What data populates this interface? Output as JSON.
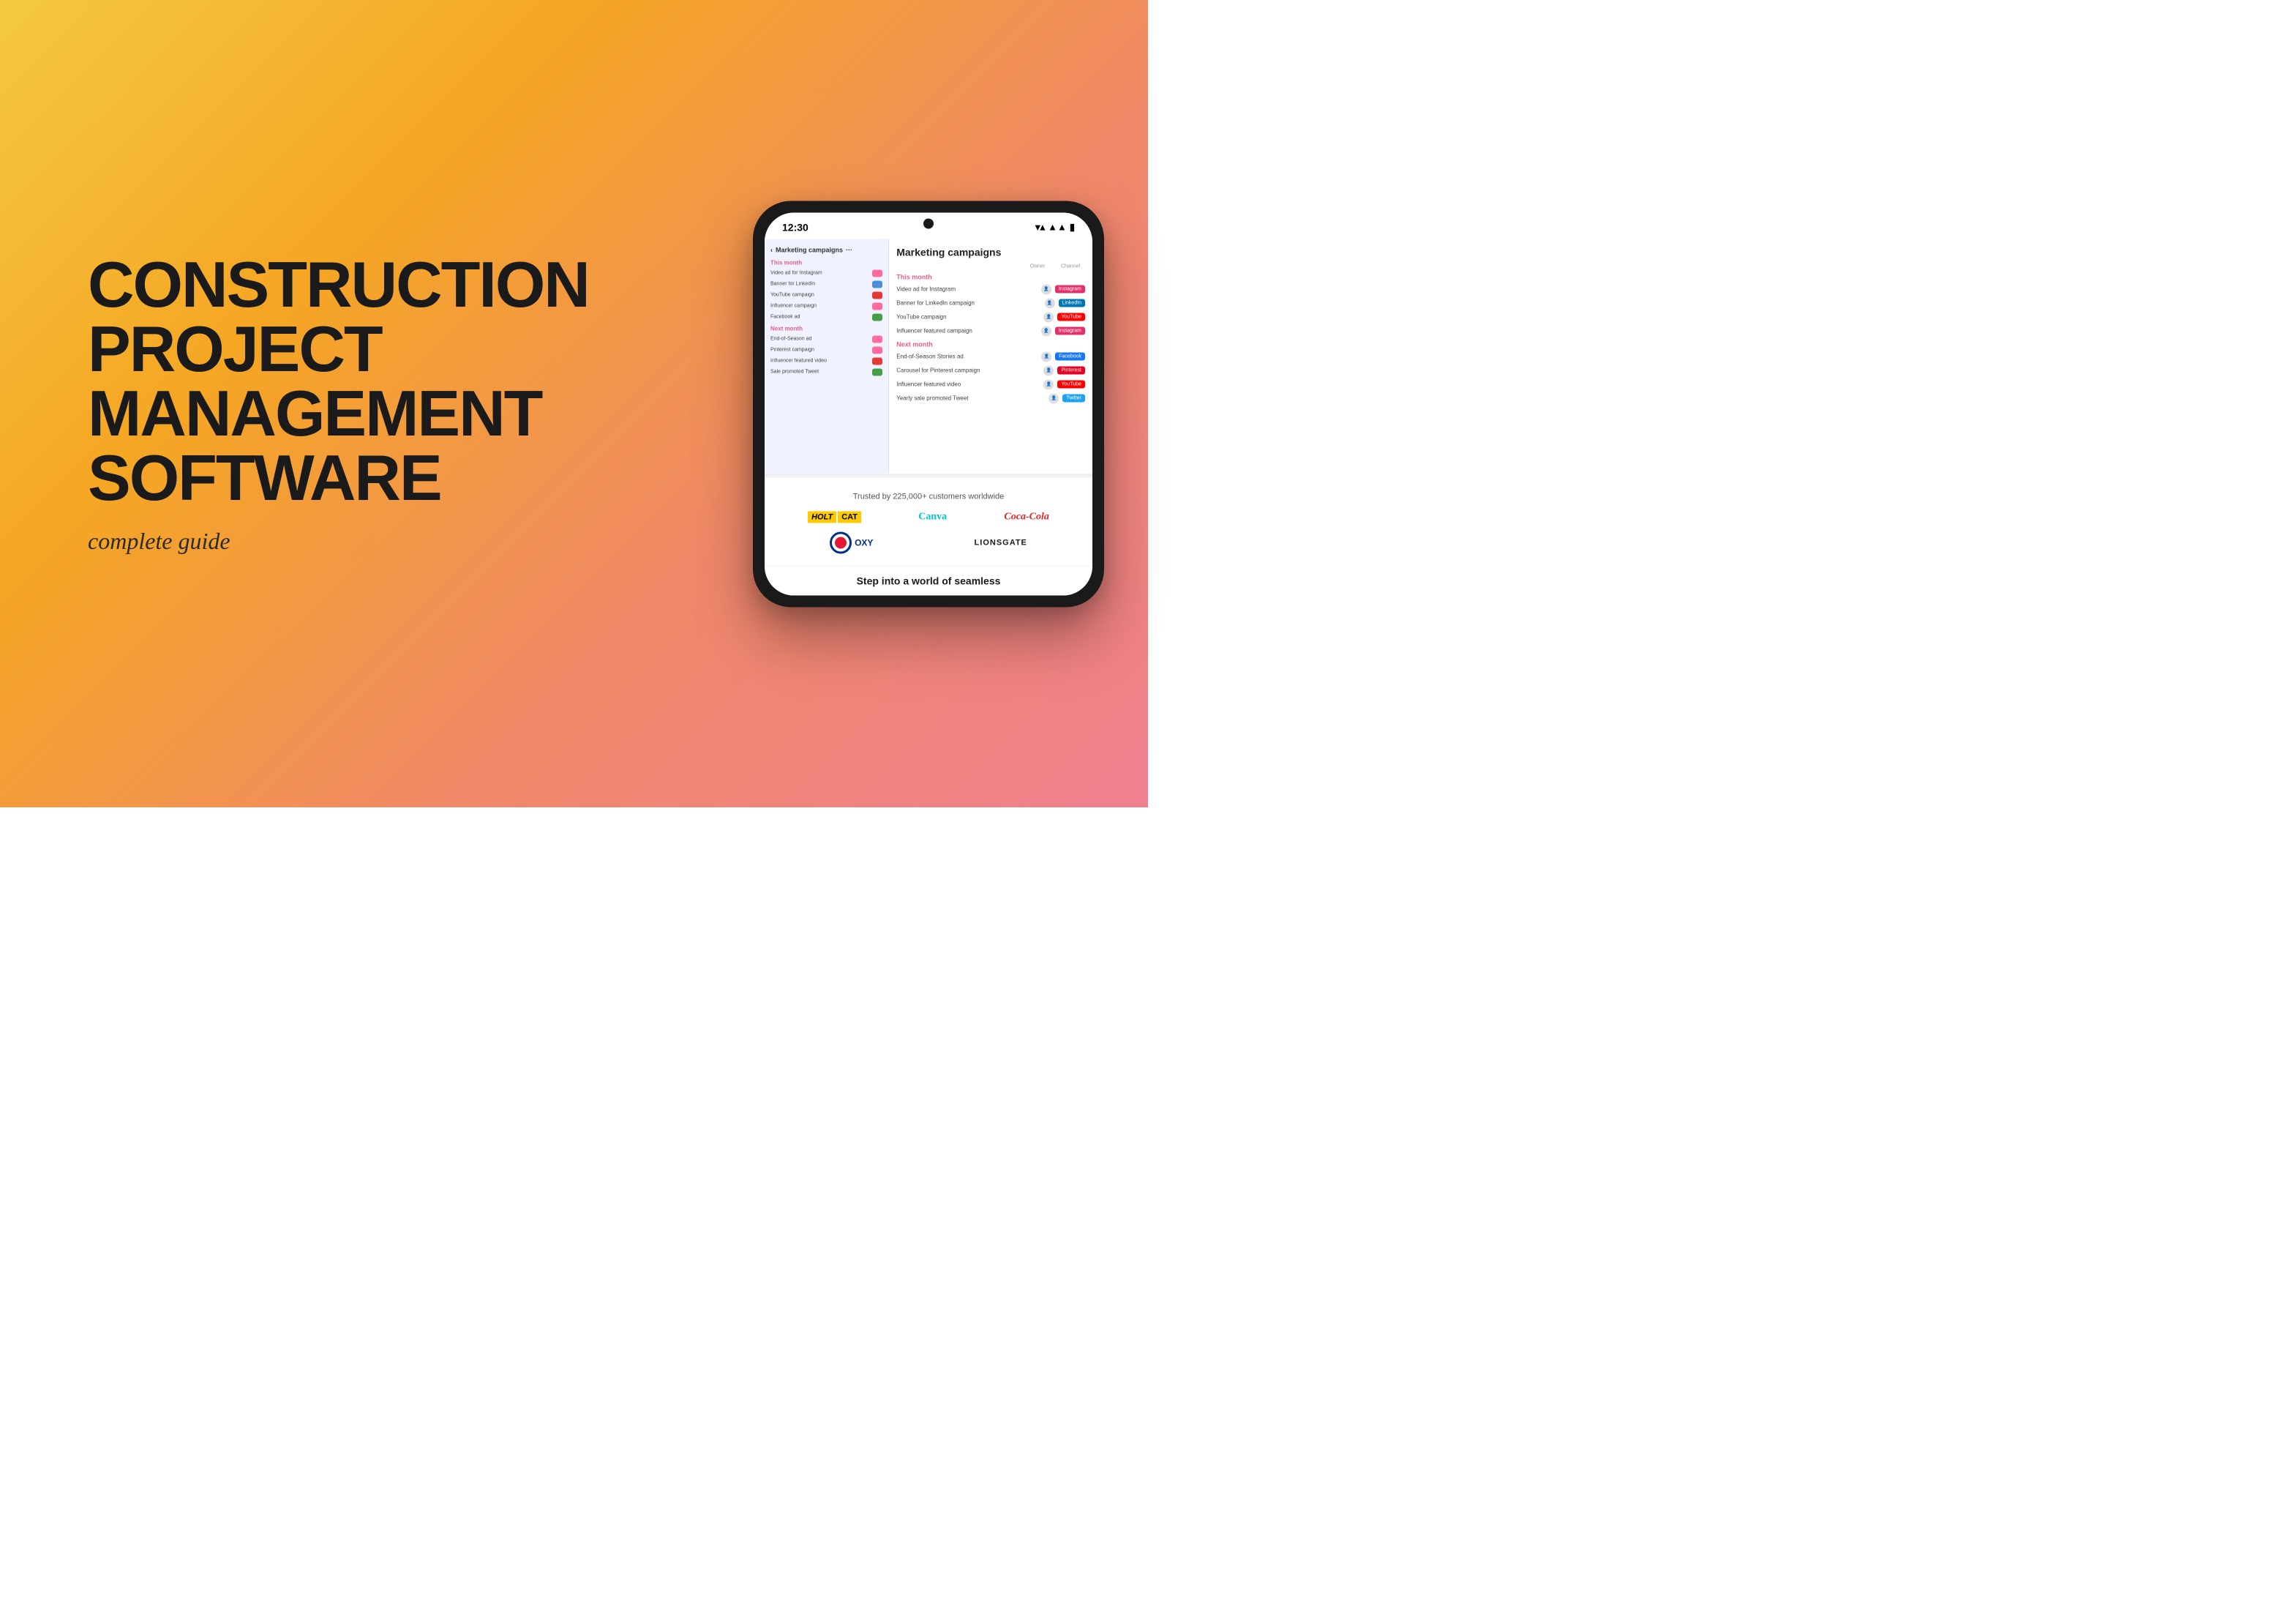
{
  "background": {
    "gradient_start": "#f5c842",
    "gradient_end": "#f08090"
  },
  "hero": {
    "title_line1": "CONSTRUCTION",
    "title_line2": "PROJECT",
    "title_line3": "MANAGEMENT",
    "title_line4": "SOFTWARE",
    "subtitle": "complete guide"
  },
  "phone": {
    "status_time": "12:30",
    "app_title": "Marketing campaigns",
    "this_month_label": "This month",
    "next_month_label": "Next month",
    "owner_col": "Owner",
    "channel_col": "Channel",
    "left_campaigns_this_month": [
      {
        "name": "Video ad for Instagram",
        "tag": "pink"
      },
      {
        "name": "Banner for LinkedIn",
        "tag": "blue"
      },
      {
        "name": "YouTube campaign",
        "tag": "red"
      },
      {
        "name": "Influencer campaign",
        "tag": "pink"
      },
      {
        "name": "Facebook ad",
        "tag": "green"
      }
    ],
    "left_campaigns_next_month": [
      {
        "name": "End-of-Season ad",
        "tag": "pink"
      },
      {
        "name": "Pinterest campaign",
        "tag": "pink"
      },
      {
        "name": "Influencer featured video",
        "tag": "red"
      },
      {
        "name": "Sale promoted Tweet",
        "tag": "green"
      }
    ],
    "right_campaigns_this_month": [
      {
        "name": "Video ad for Instagram",
        "channel": "Instagram",
        "channel_color": "#e1306c"
      },
      {
        "name": "Banner for LinkedIn campaign",
        "channel": "LinkedIn",
        "channel_color": "#0077b5"
      },
      {
        "name": "YouTube campaign",
        "channel": "YouTube",
        "channel_color": "#ff0000"
      },
      {
        "name": "Influencer featured campaign",
        "channel": "Instagram",
        "channel_color": "#e1306c"
      }
    ],
    "right_campaigns_next_month": [
      {
        "name": "End-of-Season Stories ad",
        "channel": "Facebook",
        "channel_color": "#1877f2"
      },
      {
        "name": "Carousel for Pinterest campaign",
        "channel": "Pinterest",
        "channel_color": "#e60023"
      },
      {
        "name": "Influencer featured video",
        "channel": "YouTube",
        "channel_color": "#ff0000"
      },
      {
        "name": "Yearly sale promoted Tweet",
        "channel": "Twitter",
        "channel_color": "#1da1f2"
      }
    ],
    "trusted_text": "Trusted by 225,000+ customers worldwide",
    "logos": [
      "HOLT CAT",
      "Canva",
      "Coca-Cola",
      "OXY",
      "LIONSGATE"
    ],
    "bottom_text": "Step into a world of seamless"
  }
}
